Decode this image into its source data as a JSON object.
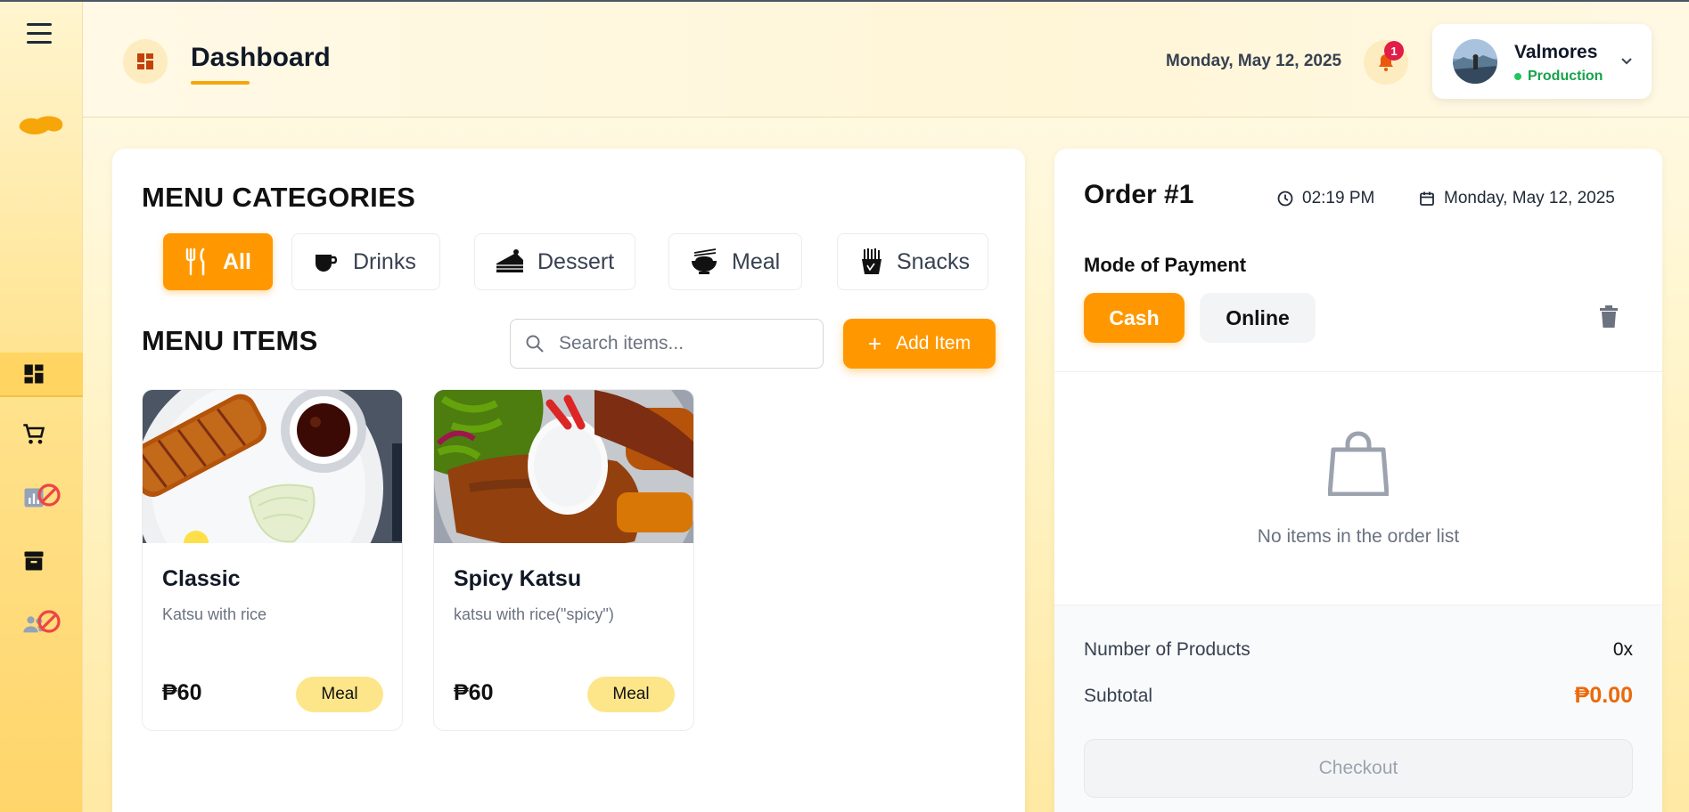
{
  "header": {
    "title": "Dashboard",
    "date": "Monday, May 12, 2025",
    "notifications_count": "1",
    "user": {
      "name": "Valmores",
      "status": "Production"
    }
  },
  "sidebar": {
    "items": [
      {
        "icon": "dashboard-icon",
        "active": true
      },
      {
        "icon": "cart-icon",
        "active": false
      },
      {
        "icon": "reports-icon",
        "active": false,
        "blocked": true
      },
      {
        "icon": "archive-icon",
        "active": false
      },
      {
        "icon": "users-icon",
        "active": false,
        "blocked": true
      }
    ]
  },
  "menu": {
    "categories_title": "MENU CATEGORIES",
    "categories": [
      {
        "label": "All",
        "icon": "utensils-icon",
        "active": true
      },
      {
        "label": "Drinks",
        "icon": "coffee-cup-icon",
        "active": false
      },
      {
        "label": "Dessert",
        "icon": "cake-slice-icon",
        "active": false
      },
      {
        "label": "Meal",
        "icon": "rice-bowl-icon",
        "active": false
      },
      {
        "label": "Snacks",
        "icon": "fries-icon",
        "active": false
      }
    ],
    "items_title": "MENU ITEMS",
    "search_placeholder": "Search items...",
    "add_label": "Add Item",
    "items": [
      {
        "name": "Classic",
        "description": "Katsu with rice",
        "price": "₱60",
        "category": "Meal"
      },
      {
        "name": "Spicy Katsu",
        "description": "katsu with rice(\"spicy\")",
        "price": "₱60",
        "category": "Meal"
      }
    ]
  },
  "order": {
    "title": "Order #1",
    "time": "02:19 PM",
    "date": "Monday, May 12, 2025",
    "payment_label": "Mode of Payment",
    "payment_options": [
      "Cash",
      "Online"
    ],
    "selected_payment": "Cash",
    "empty_text": "No items in the order list",
    "products_label": "Number of Products",
    "products_value": "0x",
    "subtotal_label": "Subtotal",
    "subtotal_value": "₱0.00",
    "checkout_label": "Checkout"
  },
  "colors": {
    "accent": "#ff9800",
    "tag": "#fde68a",
    "status_green": "#16a34a",
    "badge_red": "#e11d48"
  }
}
